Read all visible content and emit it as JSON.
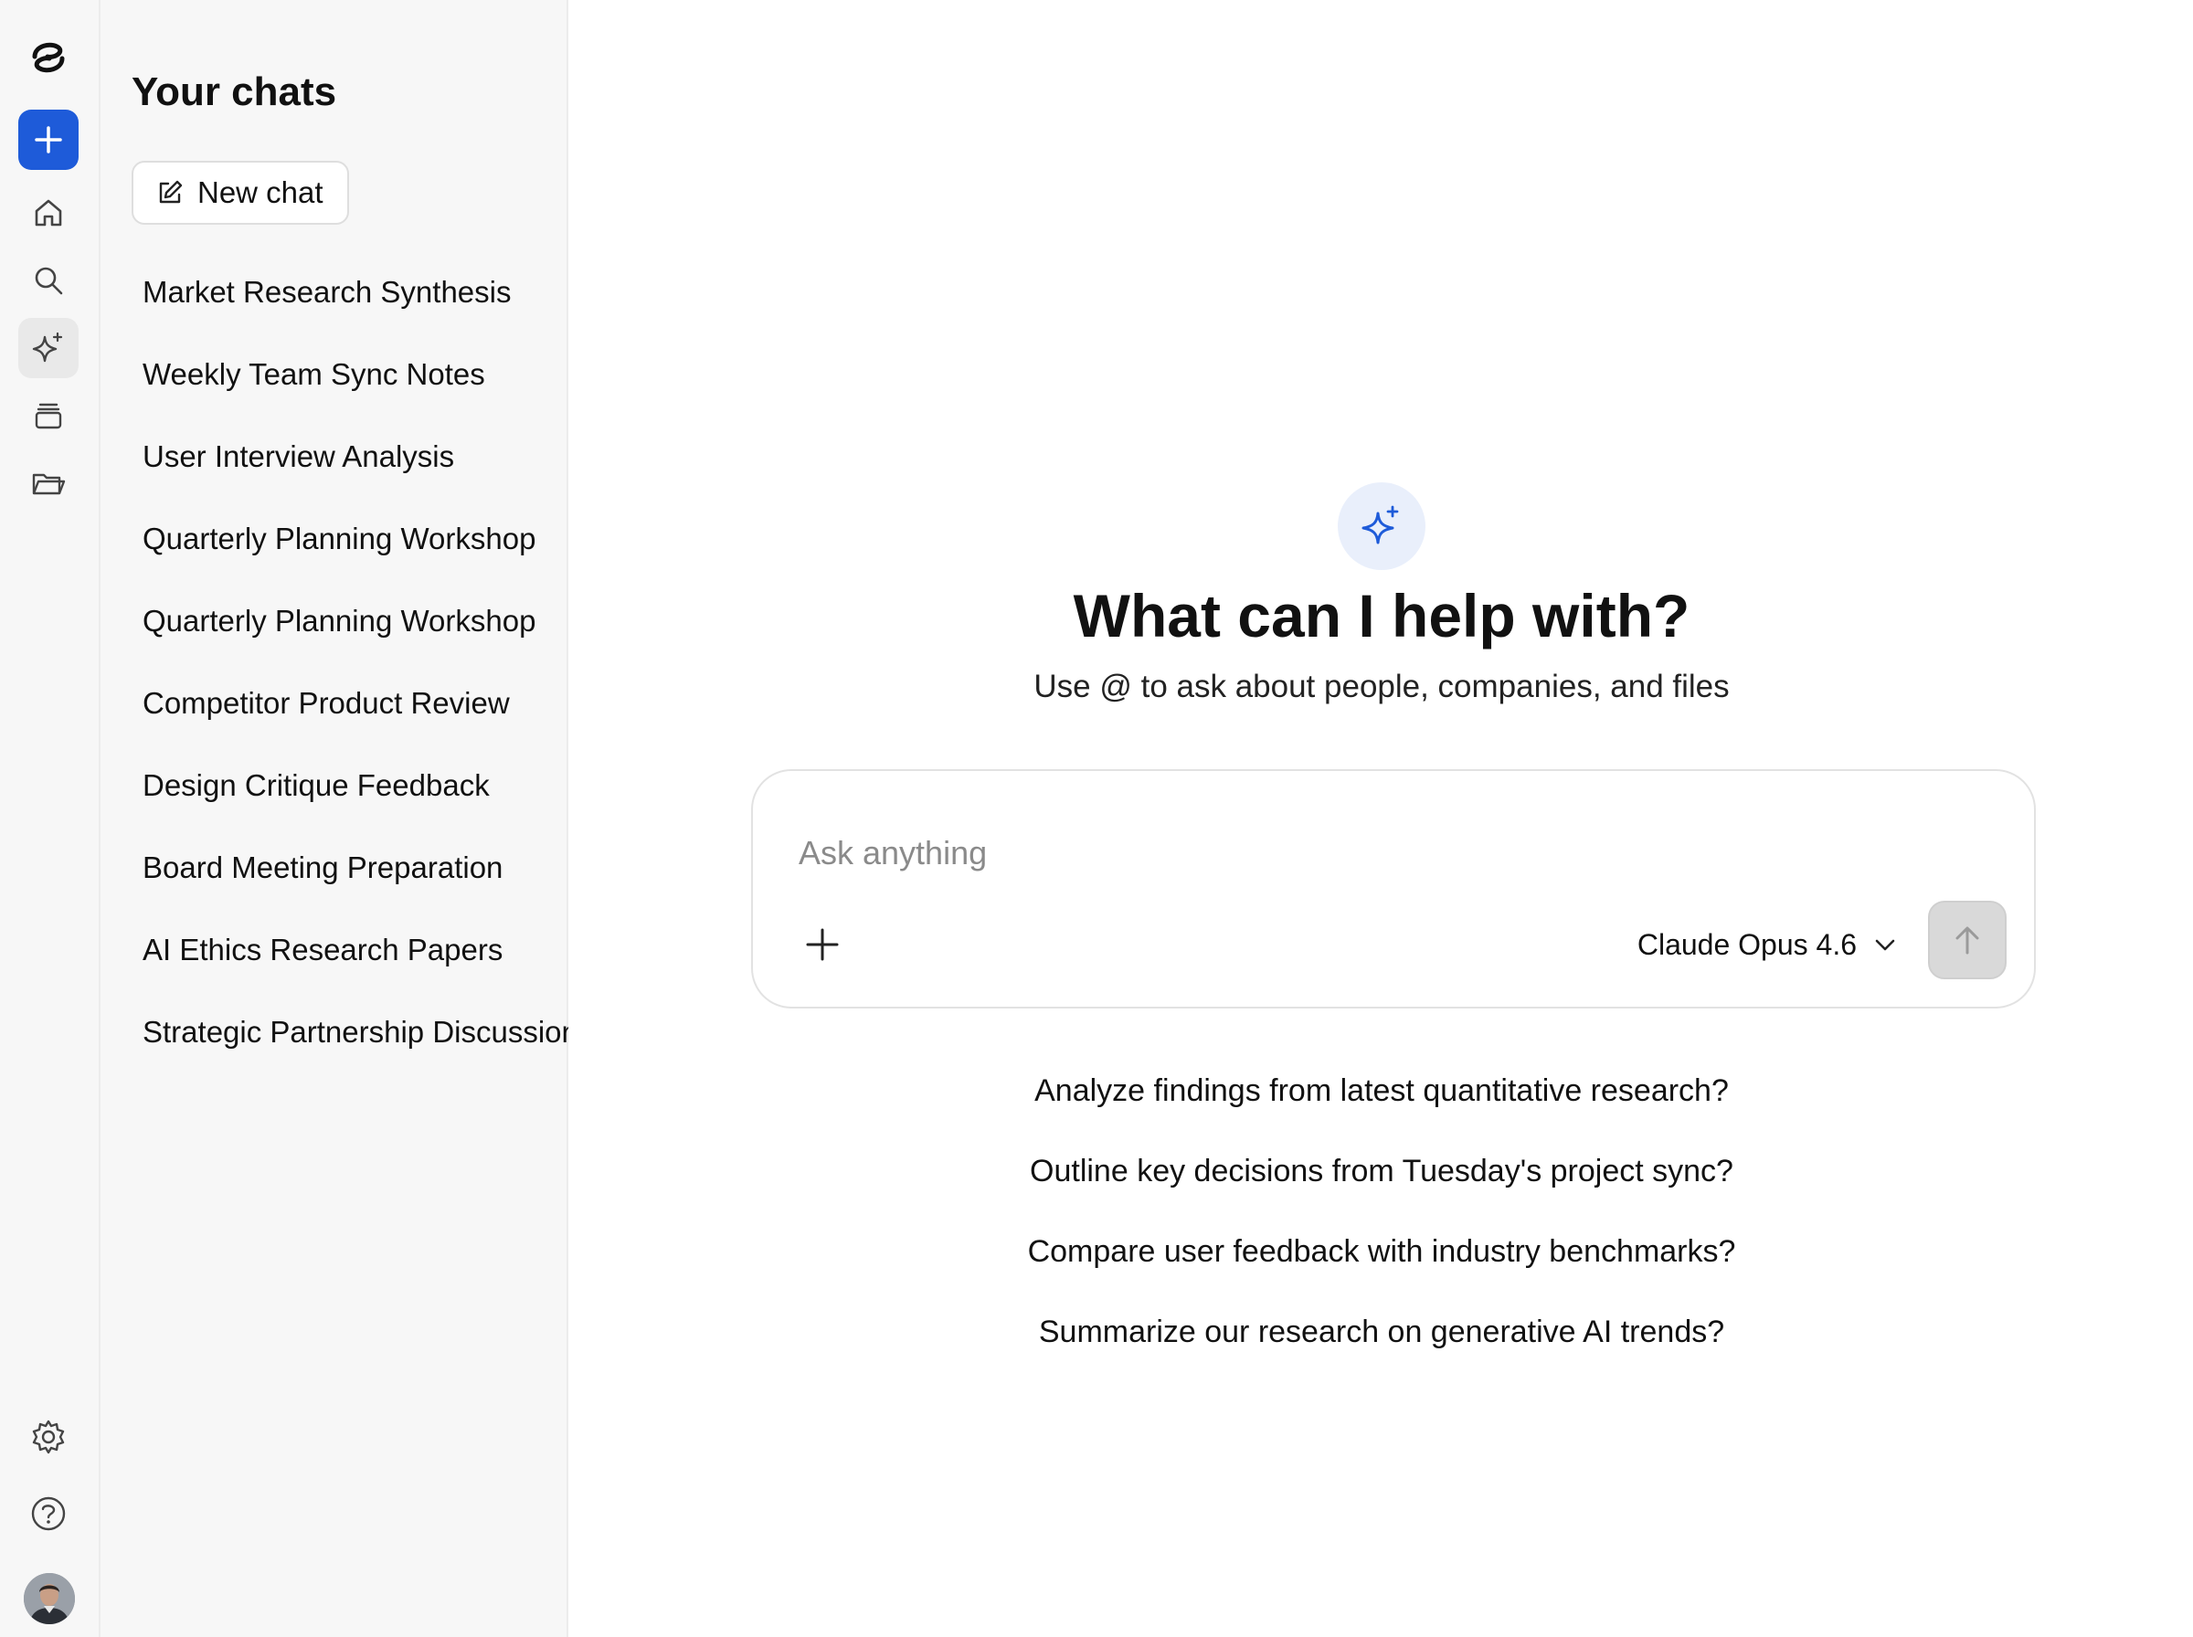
{
  "rail": {
    "icons": [
      "logo-icon",
      "plus-icon",
      "home-icon",
      "search-icon",
      "sparkle-icon",
      "stack-icon",
      "folder-icon",
      "gear-icon",
      "help-icon"
    ],
    "accent": "#1e5bd9"
  },
  "sidebar": {
    "title": "Your chats",
    "new_chat_label": "New chat",
    "chats": [
      "Market Research Synthesis",
      "Weekly Team Sync Notes",
      "User Interview Analysis",
      "Quarterly Planning Workshop",
      "Quarterly Planning Workshop",
      "Competitor Product Review",
      "Design Critique Feedback",
      "Board Meeting Preparation",
      "AI Ethics Research Papers",
      "Strategic Partnership Discussion"
    ]
  },
  "main": {
    "headline": "What can I help with?",
    "subline": "Use @ to ask about people, companies, and files",
    "composer": {
      "placeholder": "Ask anything",
      "value": "",
      "model": "Claude Opus 4.6"
    },
    "suggestions": [
      "Analyze findings from latest quantitative research?",
      "Outline key decisions from Tuesday's project sync?",
      "Compare user feedback with industry benchmarks?",
      "Summarize our research on generative AI trends?"
    ]
  }
}
